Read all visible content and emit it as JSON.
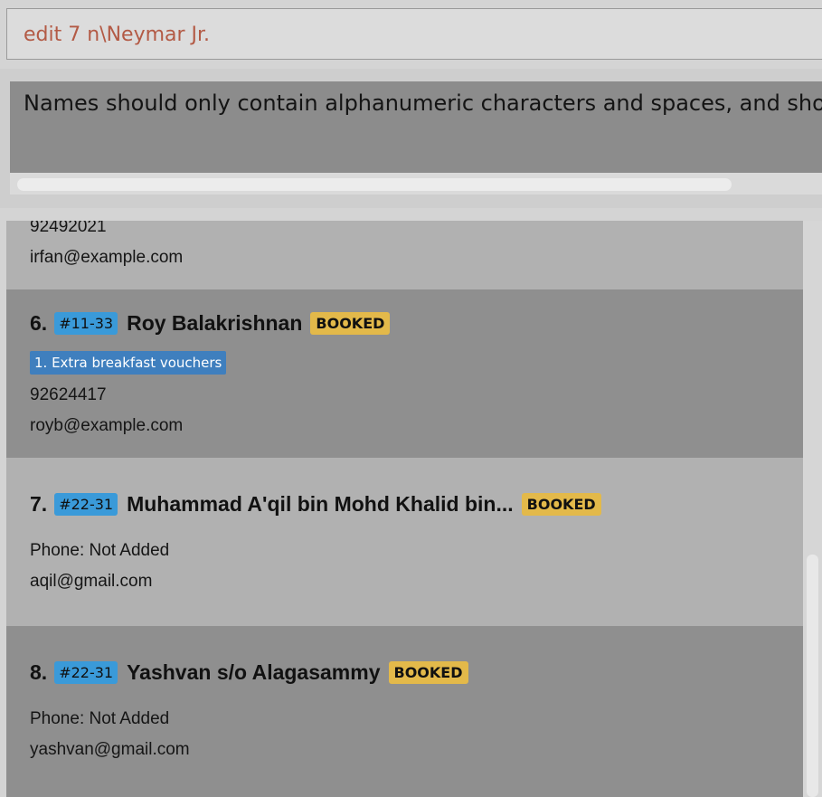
{
  "command_box": {
    "value": "edit 7 n\\Neymar Jr."
  },
  "result_display": {
    "message": "Names should only contain alphanumeric characters and spaces, and should not b"
  },
  "persons": [
    {
      "phone": "92492021",
      "email": "irfan@example.com"
    },
    {
      "index": "6.",
      "room": "#11-33",
      "name": "Roy Balakrishnan",
      "status": "BOOKED",
      "tag": "1. Extra breakfast vouchers",
      "phone": "92624417",
      "email": "royb@example.com"
    },
    {
      "index": "7.",
      "room": "#22-31",
      "name": "Muhammad A'qil bin Mohd Khalid bin...",
      "status": "BOOKED",
      "phone": "Phone: Not Added",
      "email": "aqil@gmail.com"
    },
    {
      "index": "8.",
      "room": "#22-31",
      "name": "Yashvan s/o Alagasammy",
      "status": "BOOKED",
      "phone": "Phone: Not Added",
      "email": "yashvan@gmail.com"
    }
  ],
  "colors": {
    "command_text": "#b35a45",
    "room_badge": "#3a9ad9",
    "booked_badge": "#e3b94a",
    "tag_badge": "#3f7fbe"
  }
}
